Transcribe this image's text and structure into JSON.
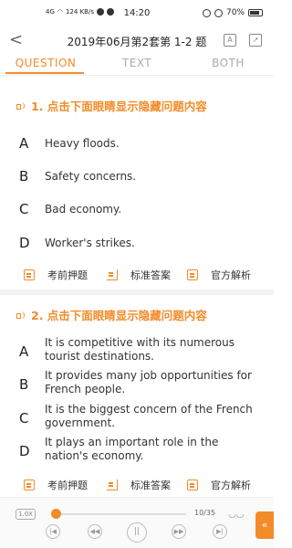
{
  "status_bar": {
    "network": "4G",
    "speed": "124 KB/s",
    "time": "14:20",
    "battery": "70%"
  },
  "header": {
    "title": "2019年06月第2套第 1-2 题",
    "back_icon": "chevron-left-icon",
    "font_icon": "A",
    "share_icon": "share-icon"
  },
  "tabs": [
    {
      "label": "QUESTION",
      "active": true
    },
    {
      "label": "TEXT",
      "active": false
    },
    {
      "label": "BOTH",
      "active": false
    }
  ],
  "questions": [
    {
      "heading": "1. 点击下面眼睛显示隐藏问题内容",
      "options": [
        {
          "letter": "A",
          "text": "Heavy floods."
        },
        {
          "letter": "B",
          "text": "Safety concerns."
        },
        {
          "letter": "C",
          "text": "Bad economy."
        },
        {
          "letter": "D",
          "text": "Worker's strikes."
        }
      ],
      "actions": [
        "考前押题",
        "标准答案",
        "官方解析"
      ]
    },
    {
      "heading": "2. 点击下面眼睛显示隐藏问题内容",
      "options": [
        {
          "letter": "A",
          "text": "It is competitive with its numerous tourist destinations."
        },
        {
          "letter": "B",
          "text": "It provides many job opportunities for French people."
        },
        {
          "letter": "C",
          "text": "It is the biggest concern of the French government."
        },
        {
          "letter": "D",
          "text": "It plays an important role in the nation's economy."
        }
      ],
      "actions": [
        "考前押题",
        "标准答案",
        "官方解析"
      ]
    }
  ],
  "player": {
    "speed": "1.0X",
    "progress": 0.02,
    "count": "10/35",
    "side_button": "«"
  },
  "colors": {
    "accent": "#f28c28",
    "text": "#222222",
    "muted": "#aaaaaa"
  }
}
